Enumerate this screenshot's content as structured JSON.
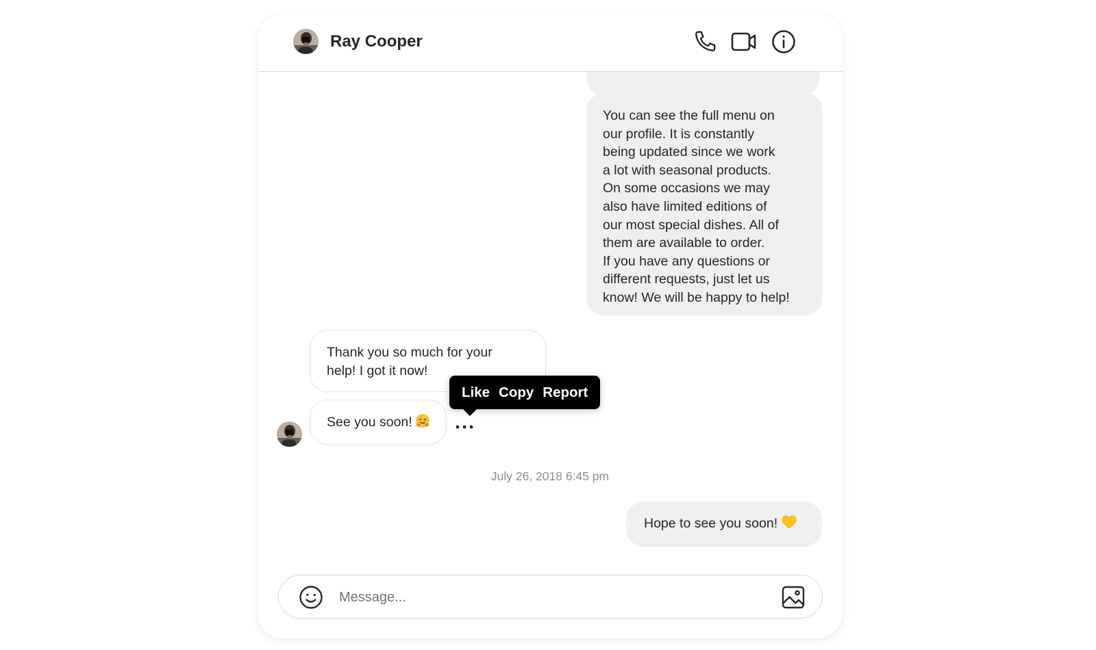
{
  "header": {
    "contact_name": "Ray Cooper",
    "icons": [
      "phone-icon",
      "video-camera-icon",
      "info-icon"
    ]
  },
  "messages": [
    {
      "direction": "outgoing",
      "text": "You can see the full menu on\nour profile. It is constantly\nbeing updated since we work\na lot with seasonal products.\nOn some occasions we may\nalso have limited editions of\nour most special dishes. All of\nthem are available to order.\nIf you have any questions or\ndifferent requests, just let us\nknow! We will be happy to help!"
    },
    {
      "direction": "incoming",
      "text": "Thank you so much for your\nhelp! I got it now!"
    },
    {
      "direction": "incoming",
      "text": "See you soon!",
      "emoji": "hugging-face-emoji"
    },
    {
      "direction": "outgoing",
      "text": "Hope to see you soon!",
      "emoji": "yellow-heart-emoji"
    }
  ],
  "context_menu": {
    "like": "Like",
    "copy": "Copy",
    "report": "Report"
  },
  "timestamp": "July 26, 2018 6:45 pm",
  "composer": {
    "placeholder": "Message...",
    "value": ""
  },
  "colors": {
    "outgoing_bubble": "#efefef",
    "incoming_border": "#e3e3e3",
    "tooltip_bg": "#000000",
    "timestamp": "#8e8e8e"
  }
}
